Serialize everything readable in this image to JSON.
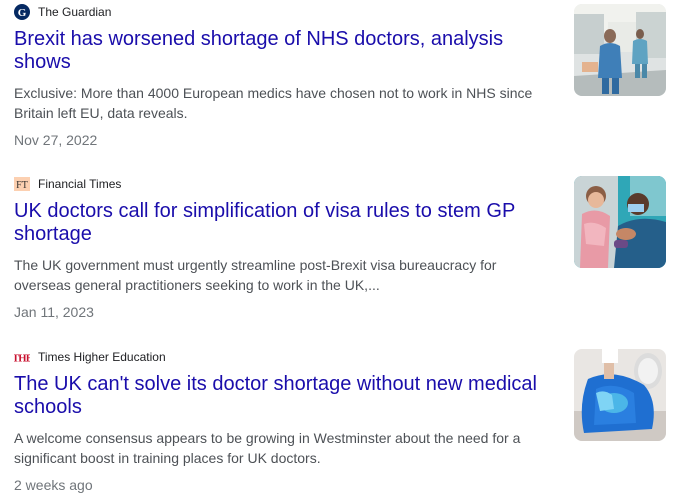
{
  "results": [
    {
      "source": "The Guardian",
      "source_icon": "guardian-logo-icon",
      "headline": "Brexit has worsened shortage of NHS doctors, analysis shows",
      "snippet": "Exclusive: More than 4000 European medics have chosen not to work in NHS since Britain left EU, data reveals.",
      "date": "Nov 27, 2022",
      "thumbnail": "hospital-corridor-thumbnail"
    },
    {
      "source": "Financial Times",
      "source_icon": "ft-logo-icon",
      "source_logo_text": "FT",
      "headline": "UK doctors call for simplification of visa rules to stem GP shortage",
      "snippet": "The UK government must urgently streamline post-Brexit visa bureaucracy for overseas general practitioners seeking to work in the UK,...",
      "date": "Jan 11, 2023",
      "thumbnail": "doctor-child-thumbnail"
    },
    {
      "source": "Times Higher Education",
      "source_icon": "the-logo-icon",
      "source_logo_text": "THE",
      "headline": "The UK can't solve its doctor shortage without new medical schools",
      "snippet": "A welcome consensus appears to be growing in Westminster about the need for a significant boost in training places for UK doctors.",
      "date": "2 weeks ago",
      "thumbnail": "cpr-training-thumbnail"
    }
  ],
  "colors": {
    "headline": "#1a0dab",
    "snippet": "#4d5156",
    "date": "#70757a",
    "source": "#202124",
    "ft_pink": "#fcd0b1",
    "the_red": "#c8102e"
  }
}
